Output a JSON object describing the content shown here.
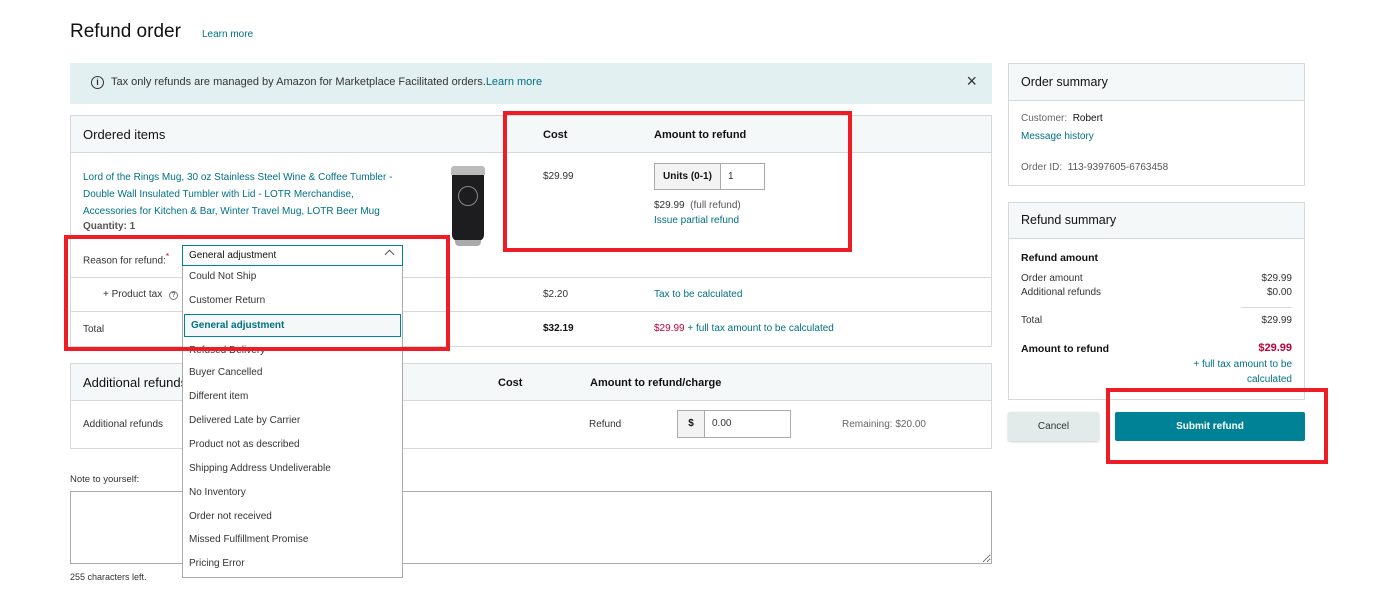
{
  "page": {
    "title": "Refund order",
    "learn_more": "Learn more"
  },
  "banner": {
    "icon": "info-icon",
    "text": "Tax only refunds are managed by Amazon for Marketplace Facilitated orders.",
    "link": "Learn more",
    "close_icon": "close-icon"
  },
  "ordered_items": {
    "header": "Ordered items",
    "cost_header": "Cost",
    "amount_header": "Amount to refund",
    "item": {
      "title": "Lord of the Rings Mug, 30 oz Stainless Steel Wine & Coffee Tumbler - Double Wall Insulated Tumbler with Lid - LOTR Merchandise, Accessories for Kitchen & Bar, Winter Travel Mug, LOTR Beer Mug",
      "quantity_label": "Quantity:",
      "quantity": "1",
      "cost": "$29.99",
      "units_label": "Units (0-1)",
      "units_value": "1",
      "refund_amount": "$29.99",
      "refund_note": "(full refund)",
      "partial_link": "Issue partial refund"
    },
    "reason_label": "Reason for refund:",
    "required_mark": "*",
    "reason_selected": "General adjustment",
    "reason_options": [
      "Could Not Ship",
      "Customer Return",
      "General adjustment",
      "Refused Delivery",
      "Buyer Cancelled",
      "Different item",
      "Delivered Late by Carrier",
      "Product not as described",
      "Shipping Address Undeliverable",
      "No Inventory",
      "Order not received",
      "Missed Fulfillment Promise",
      "Pricing Error"
    ],
    "tax_label": "+ Product tax",
    "tax_cost": "$2.20",
    "tax_amount": "Tax to be calculated",
    "total_label": "Total",
    "total_cost": "$32.19",
    "total_refund": "$29.99",
    "total_refund_note": "+ full tax amount to be calculated"
  },
  "additional_refunds": {
    "header": "Additional refunds",
    "cost_header": "Cost",
    "amount_header": "Amount to refund/charge",
    "row_label": "Additional refunds",
    "type": "Refund",
    "currency": "$",
    "value": "0.00",
    "remaining": "Remaining: $20.00"
  },
  "note": {
    "label": "Note to yourself:",
    "value": "",
    "chars_left": "255 characters left."
  },
  "order_summary": {
    "header": "Order summary",
    "customer_label": "Customer:",
    "customer": "Robert",
    "message_history": "Message history",
    "order_id_label": "Order ID:",
    "order_id": "113-9397605-6763458"
  },
  "refund_summary": {
    "header": "Refund summary",
    "section": "Refund amount",
    "order_amount_label": "Order amount",
    "order_amount": "$29.99",
    "additional_label": "Additional refunds",
    "additional": "$0.00",
    "total_label": "Total",
    "total": "$29.99",
    "amount_label": "Amount to refund",
    "amount": "$29.99",
    "amount_note": "+ full tax amount to be calculated"
  },
  "actions": {
    "cancel": "Cancel",
    "submit": "Submit refund"
  },
  "colors": {
    "accent": "#008296",
    "link": "#007185",
    "price_red": "#c40035",
    "annotation": "#ee1c25"
  }
}
